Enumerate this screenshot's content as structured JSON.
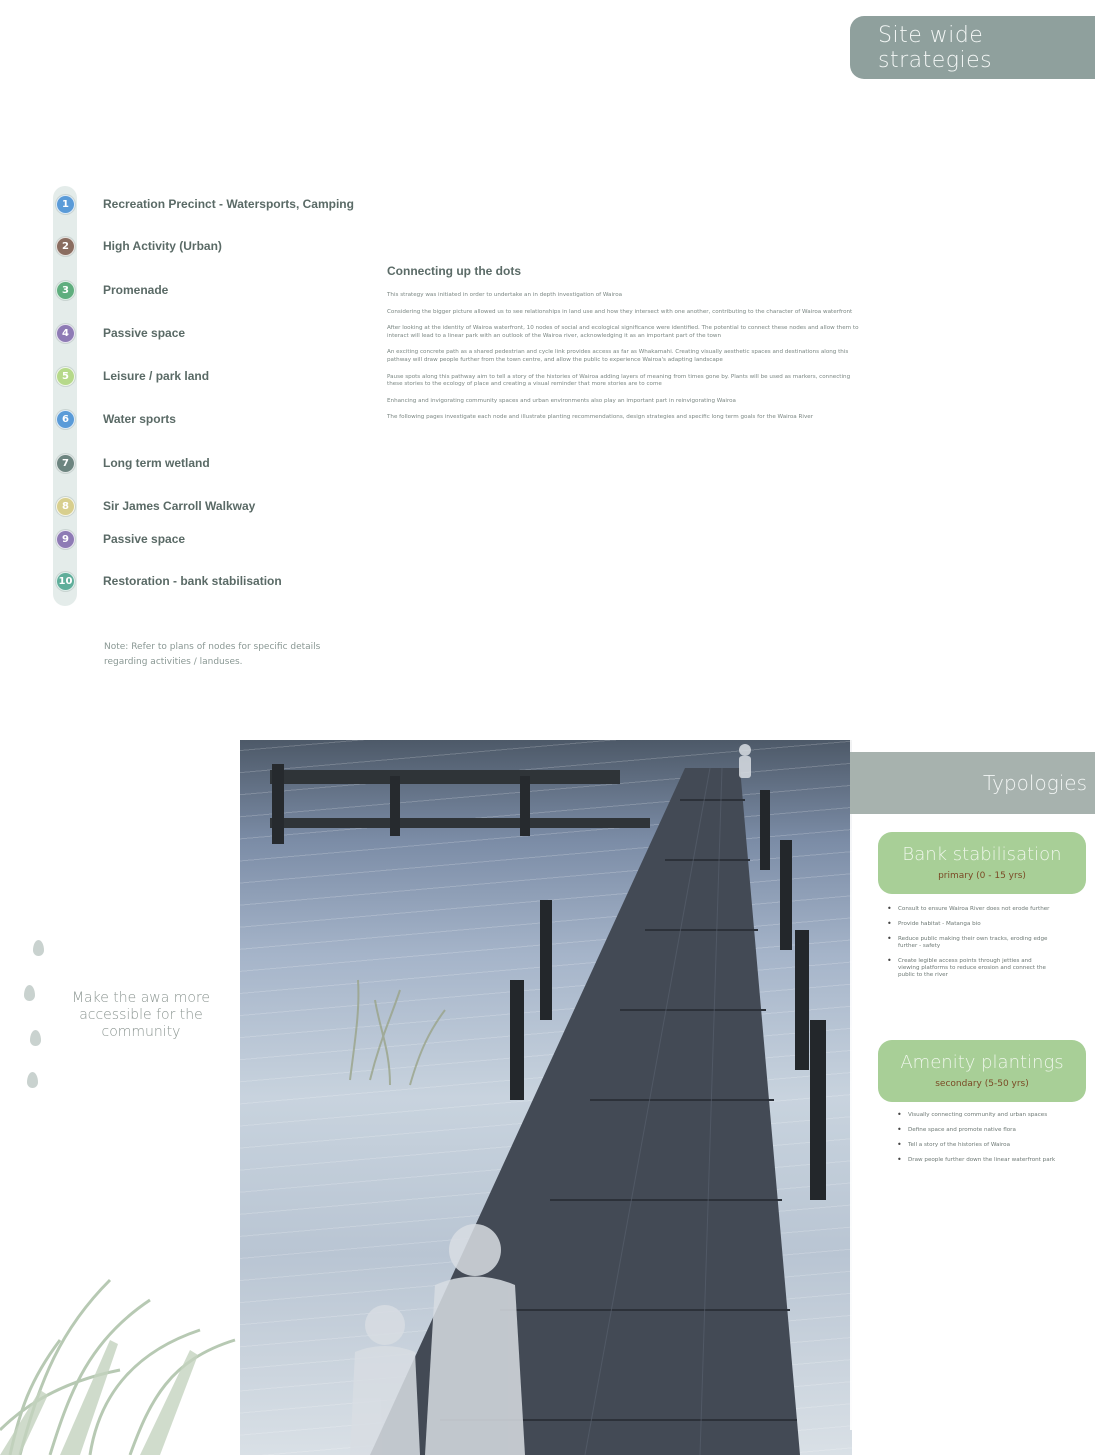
{
  "header": {
    "banner": "Site wide strategies"
  },
  "nodes": [
    {
      "num": "1",
      "label": "Recreation Precinct - Watersports, Camping",
      "color": "#5a9bd8"
    },
    {
      "num": "2",
      "label": "High Activity (Urban)",
      "color": "#8a6d60"
    },
    {
      "num": "3",
      "label": "Promenade",
      "color": "#5fae7e"
    },
    {
      "num": "4",
      "label": "Passive space",
      "color": "#8e7bb5"
    },
    {
      "num": "5",
      "label": "Leisure / park land",
      "color": "#b6d98a"
    },
    {
      "num": "6",
      "label": "Water sports",
      "color": "#5a9bd8"
    },
    {
      "num": "7",
      "label": "Long term wetland",
      "color": "#6d8580"
    },
    {
      "num": "8",
      "label": "Sir James Carroll Walkway",
      "color": "#d8cf8e"
    },
    {
      "num": "9",
      "label": "Passive space",
      "color": "#8e7bb5"
    },
    {
      "num": "10",
      "label": "Restoration - bank stabilisation",
      "color": "#5fae9a"
    }
  ],
  "legend_note": "Note: Refer to plans of nodes for specific details regarding activities / landuses.",
  "intro": {
    "heading": "Connecting up the dots",
    "paragraphs": [
      "This strategy was initiated in order to undertake an in depth investigation of Wairoa",
      "Considering the bigger picture allowed us to see relationships in land use and how they intersect with one another, contributing to the character of Wairoa waterfront",
      "After looking at the identity of Wairoa waterfront, 10 nodes of social and ecological significance were identified. The potential to connect these nodes and allow them to interact will lead to a linear park with an outlook of the Wairoa river, acknowledging it as an important part of the town",
      "An exciting concrete path as a shared pedestrian and cycle link provides access as far as Whakamahi. Creating visually aesthetic spaces and destinations along this pathway will draw people further from the town centre, and allow the public to experience Wairoa's adapting landscape",
      "Pause spots along this pathway aim to tell a story of the histories of Wairoa adding layers of meaning from times gone by. Plants will be used as markers, connecting these stories to the ecology of place and creating a visual reminder that more stories are to come",
      "Enhancing and invigorating community spaces and urban environments also play an important part in reinvigorating Wairoa",
      "The following pages investigate each node and illustrate planting recommendations, design strategies and specific long term goals for the Wairoa River"
    ]
  },
  "tagline": "Make the awa more accessible for the community",
  "typologies": {
    "header": "Typologies",
    "cards": [
      {
        "title": "Bank stabilisation",
        "subtitle": "primary (0 - 15 yrs)",
        "bullets": [
          "Consult to ensure Wairoa River does not erode further",
          "Provide habitat - Matanga bio",
          "Reduce public making their own tracks, eroding edge further - safety",
          "Create legible access points through jetties and viewing platforms to reduce erosion and connect the public to the river"
        ]
      },
      {
        "title": "Amenity plantings",
        "subtitle": "secondary (5-50 yrs)",
        "bullets": [
          "Visually connecting community and urban spaces",
          "Define space and promote native flora",
          "Tell a story of the histories of Wairoa",
          "Draw people further down the linear waterfront park"
        ]
      }
    ]
  },
  "colors": {
    "banner": "#8fa09d",
    "typology_header": "#a7b2ae",
    "card_green": "#a8cf97",
    "subtitle_brown": "#7a4a25"
  }
}
